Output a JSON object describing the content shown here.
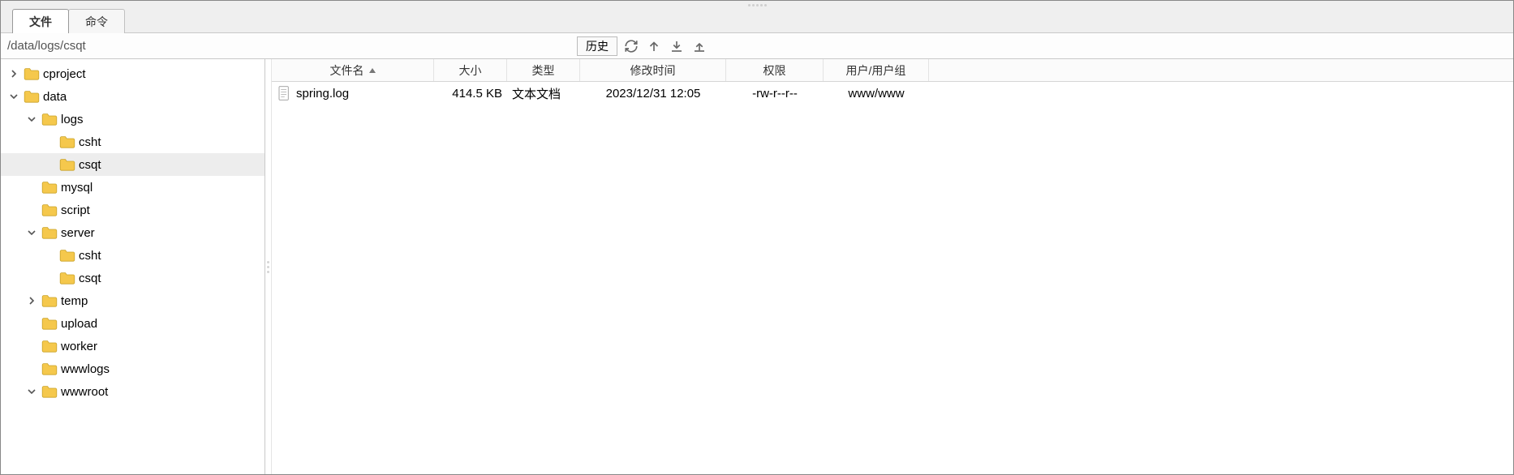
{
  "tabs": {
    "files": "文件",
    "commands": "命令"
  },
  "path": "/data/logs/csqt",
  "toolbar": {
    "history": "历史"
  },
  "table": {
    "columns": {
      "name": "文件名",
      "size": "大小",
      "type": "类型",
      "mtime": "修改时间",
      "perm": "权限",
      "owner": "用户/用户组"
    },
    "rows": [
      {
        "name": "spring.log",
        "size": "414.5 KB",
        "type": "文本文档",
        "mtime": "2023/12/31 12:05",
        "perm": "-rw-r--r--",
        "owner": "www/www"
      }
    ]
  },
  "tree": [
    {
      "depth": 0,
      "label": "cproject",
      "expander": "closed"
    },
    {
      "depth": 0,
      "label": "data",
      "expander": "open"
    },
    {
      "depth": 1,
      "label": "logs",
      "expander": "open"
    },
    {
      "depth": 2,
      "label": "csht",
      "expander": "none"
    },
    {
      "depth": 2,
      "label": "csqt",
      "expander": "none",
      "selected": true
    },
    {
      "depth": 1,
      "label": "mysql",
      "expander": "none"
    },
    {
      "depth": 1,
      "label": "script",
      "expander": "none"
    },
    {
      "depth": 1,
      "label": "server",
      "expander": "open"
    },
    {
      "depth": 2,
      "label": "csht",
      "expander": "none"
    },
    {
      "depth": 2,
      "label": "csqt",
      "expander": "none"
    },
    {
      "depth": 1,
      "label": "temp",
      "expander": "closed"
    },
    {
      "depth": 1,
      "label": "upload",
      "expander": "none"
    },
    {
      "depth": 1,
      "label": "worker",
      "expander": "none"
    },
    {
      "depth": 1,
      "label": "wwwlogs",
      "expander": "none"
    },
    {
      "depth": 1,
      "label": "wwwroot",
      "expander": "open"
    }
  ]
}
